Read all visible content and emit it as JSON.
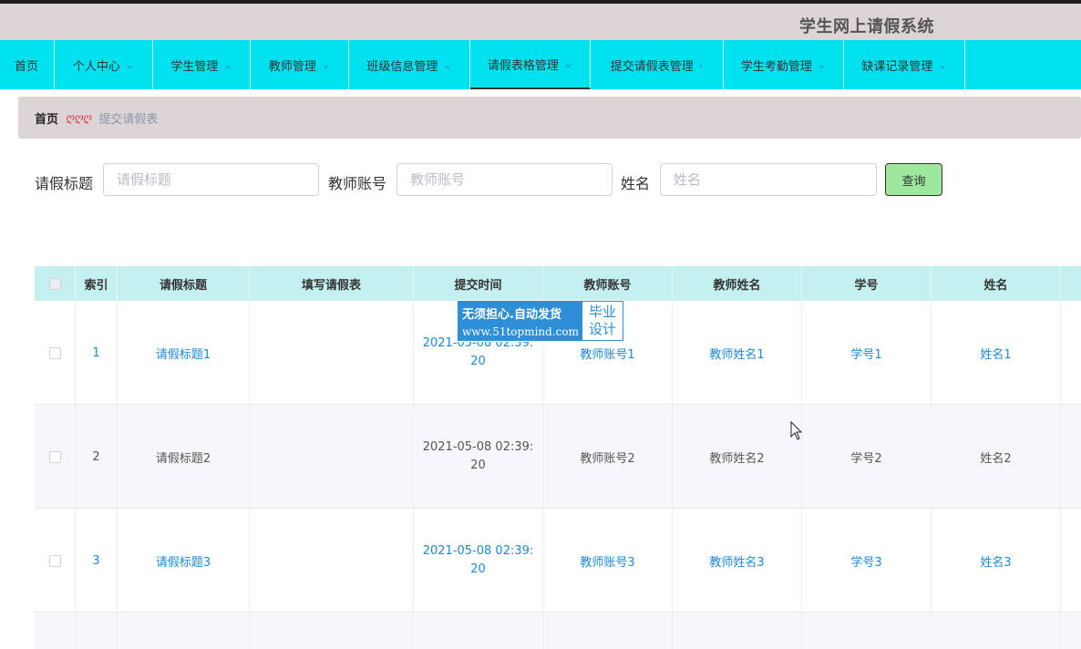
{
  "app": {
    "title": "学生网上请假系统"
  },
  "nav": {
    "items": [
      {
        "label": "首页",
        "has_dropdown": false
      },
      {
        "label": "个人中心",
        "has_dropdown": true
      },
      {
        "label": "学生管理",
        "has_dropdown": true
      },
      {
        "label": "教师管理",
        "has_dropdown": true
      },
      {
        "label": "班级信息管理",
        "has_dropdown": true
      },
      {
        "label": "请假表格管理",
        "has_dropdown": true,
        "active": true
      },
      {
        "label": "提交请假表管理",
        "has_dropdown": true,
        "expanded": true
      },
      {
        "label": "学生考勤管理",
        "has_dropdown": true
      },
      {
        "label": "缺课记录管理",
        "has_dropdown": true
      }
    ],
    "chevron_down": "⌄",
    "chevron_left": "‹"
  },
  "breadcrumb": {
    "home": "首页",
    "separator": "ღღღ",
    "current": "提交请假表"
  },
  "search": {
    "title_label": "请假标题",
    "title_placeholder": "请假标题",
    "teacher_label": "教师账号",
    "teacher_placeholder": "教师账号",
    "name_label": "姓名",
    "name_placeholder": "姓名",
    "query_button": "查询"
  },
  "table": {
    "headers": [
      "索引",
      "请假标题",
      "填写请假表",
      "提交时间",
      "教师账号",
      "教师姓名",
      "学号",
      "姓名"
    ],
    "rows": [
      {
        "index": "1",
        "title": "请假标题1",
        "form": "",
        "time": "2021-05-08 02:39:20",
        "teacher_account": "教师账号1",
        "teacher_name": "教师姓名1",
        "student_id": "学号1",
        "name": "姓名1"
      },
      {
        "index": "2",
        "title": "请假标题2",
        "form": "",
        "time": "2021-05-08 02:39:20",
        "teacher_account": "教师账号2",
        "teacher_name": "教师姓名2",
        "student_id": "学号2",
        "name": "姓名2"
      },
      {
        "index": "3",
        "title": "请假标题3",
        "form": "",
        "time": "2021-05-08 02:39:20",
        "teacher_account": "教师账号3",
        "teacher_name": "教师姓名3",
        "student_id": "学号3",
        "name": "姓名3"
      }
    ]
  },
  "watermark": {
    "main": "无须担心.自动发货",
    "url": "www.51topmind.com",
    "side_line1": "毕业",
    "side_line2": "设计"
  },
  "colors": {
    "nav_bg": "#00e1ef",
    "header_bg": "#ddd5d5",
    "link": "#1e88d8",
    "table_head": "#c4f1ef",
    "button": "#9ee79e"
  }
}
